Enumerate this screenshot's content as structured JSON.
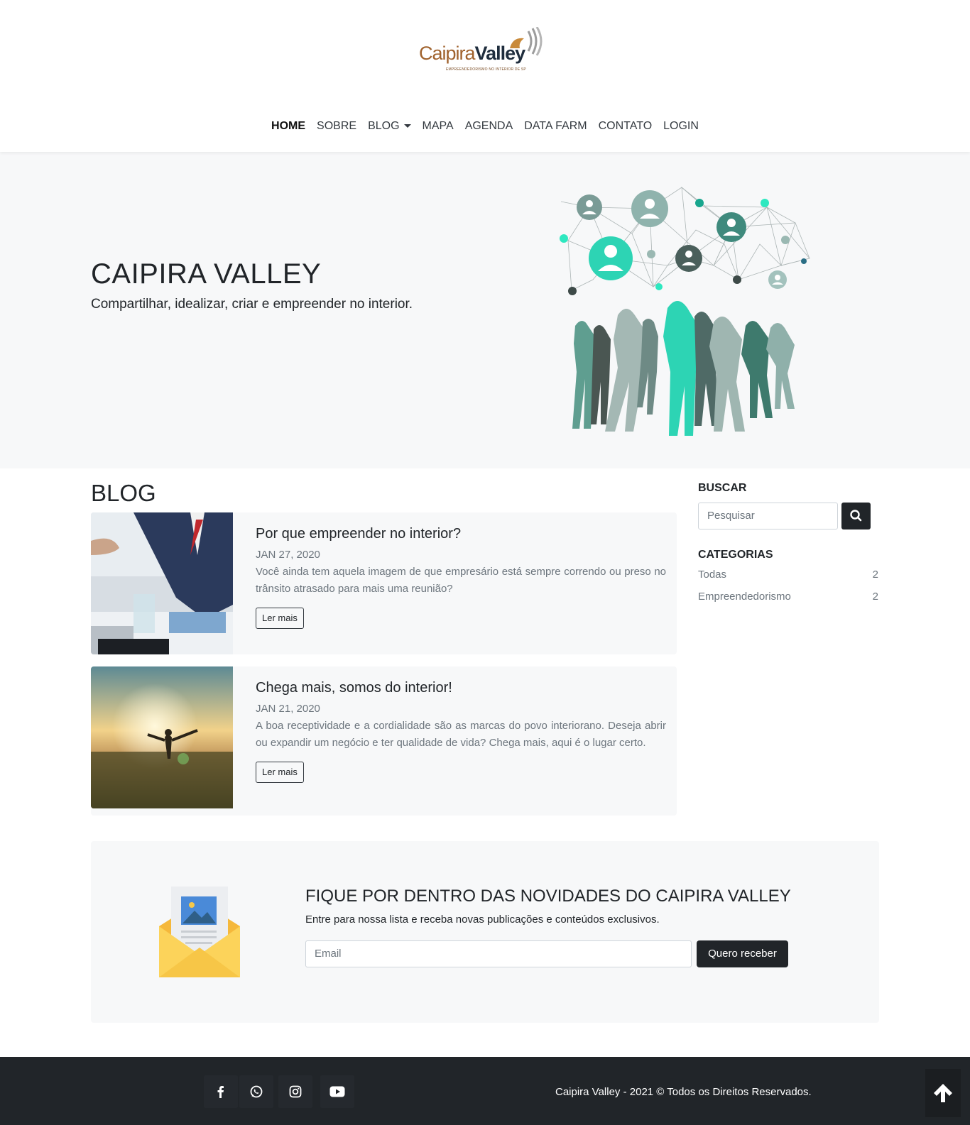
{
  "brand": {
    "logo_primary": "Caipira",
    "logo_secondary": "Valley",
    "logo_tagline": "EMPREENDEDORISMO NO INTERIOR DE SP"
  },
  "nav": {
    "items": [
      {
        "label": "HOME",
        "active": true
      },
      {
        "label": "SOBRE"
      },
      {
        "label": "BLOG",
        "dropdown": true
      },
      {
        "label": "MAPA"
      },
      {
        "label": "AGENDA"
      },
      {
        "label": "DATA FARM"
      },
      {
        "label": "CONTATO"
      },
      {
        "label": "LOGIN"
      }
    ]
  },
  "hero": {
    "title": "CAIPIRA VALLEY",
    "subtitle": "Compartilhar, idealizar, criar e empreender no interior."
  },
  "blog": {
    "heading": "BLOG",
    "posts": [
      {
        "title": "Por que empreender no interior?",
        "date": "JAN 27, 2020",
        "excerpt": "Você ainda tem aquela imagem de que empresário está sempre correndo ou preso no trânsito atrasado para mais uma reunião?",
        "button": "Ler mais"
      },
      {
        "title": "Chega mais, somos do interior!",
        "date": "JAN 21, 2020",
        "excerpt": "A boa receptividade e a cordialidade são as marcas do povo interiorano. Deseja abrir ou expandir um negócio e ter qualidade de vida? Chega mais, aqui é o lugar certo.",
        "button": "Ler mais"
      }
    ]
  },
  "sidebar": {
    "search_heading": "BUSCAR",
    "search_placeholder": "Pesquisar",
    "categories_heading": "CATEGORIAS",
    "categories": [
      {
        "label": "Todas",
        "count": "2"
      },
      {
        "label": "Empreendedorismo",
        "count": "2"
      }
    ]
  },
  "newsletter": {
    "title": "FIQUE POR DENTRO DAS NOVIDADES DO CAIPIRA VALLEY",
    "subtitle": "Entre para nossa lista e receba novas publicações e conteúdos exclusivos.",
    "email_placeholder": "Email",
    "button": "Quero receber"
  },
  "footer": {
    "social": [
      "facebook-icon",
      "whatsapp-icon",
      "instagram-icon",
      "youtube-icon"
    ],
    "copyright": "Caipira Valley - 2021 © Todos os Direitos Reservados."
  },
  "colors": {
    "dark": "#212529",
    "teal": "#2dd4b4",
    "hero_bg": "#f7f8f9"
  }
}
